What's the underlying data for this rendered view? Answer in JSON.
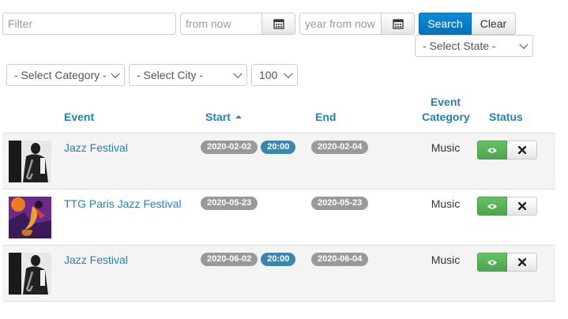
{
  "filters": {
    "filter_placeholder": "Filter",
    "from_placeholder": "from now",
    "to_placeholder": "year from now",
    "search_label": "Search",
    "clear_label": "Clear",
    "state_select": "- Select State -",
    "category_select": "- Select Category -",
    "city_select": "- Select City -",
    "limit_select": "100"
  },
  "table": {
    "headers": {
      "event": "Event",
      "start": "Start",
      "end": "End",
      "category_line1": "Event",
      "category_line2": "Category",
      "status": "Status"
    },
    "rows": [
      {
        "title": "Jazz Festival",
        "start_date": "2020-02-02",
        "start_time": "20:00",
        "end_date": "2020-02-04",
        "category": "Music"
      },
      {
        "title": "TTG Paris Jazz Festival",
        "start_date": "2020-05-23",
        "start_time": "",
        "end_date": "2020-05-23",
        "category": "Music"
      },
      {
        "title": "Jazz Festival",
        "start_date": "2020-06-02",
        "start_time": "20:00",
        "end_date": "2020-06-04",
        "category": "Music"
      }
    ]
  },
  "colors": {
    "link": "#2a7fb0",
    "primary_button": "#0073bb",
    "date_badge": "#999999",
    "time_badge": "#3a87ad",
    "publish_button": "#51a351"
  },
  "icons": {
    "calendar": "calendar-icon",
    "sort_asc": "sort-ascending-icon",
    "eye": "eye-icon",
    "close": "close-icon",
    "chevron": "chevron-down-icon"
  }
}
